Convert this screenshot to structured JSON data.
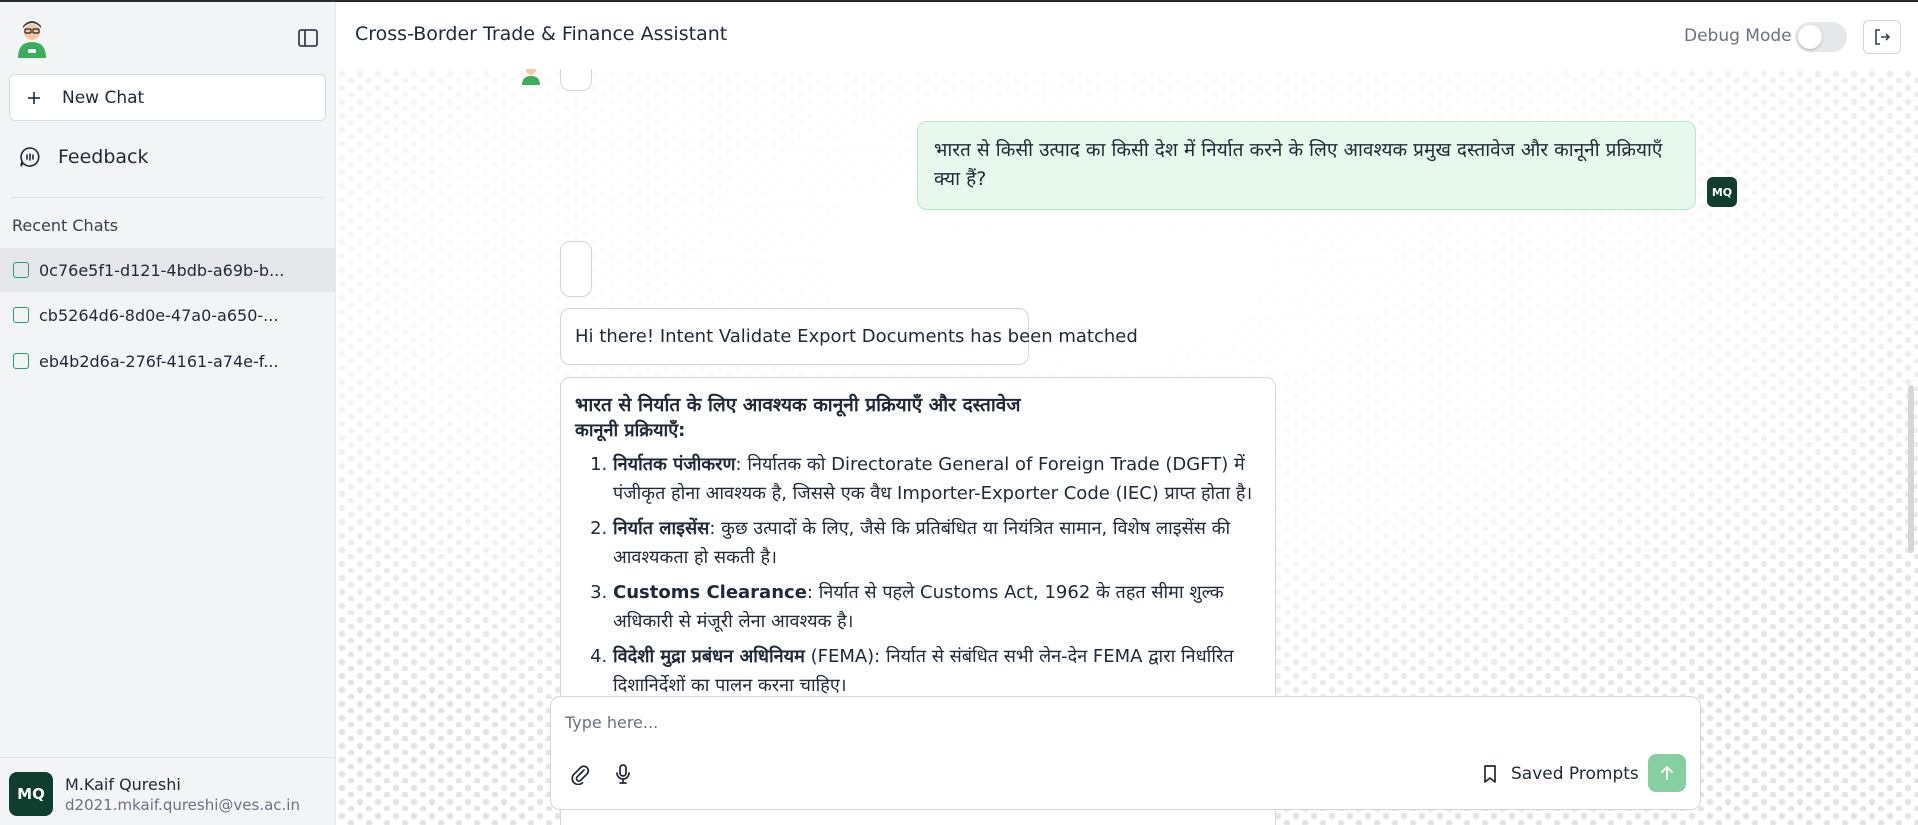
{
  "header": {
    "title": "Cross-Border Trade & Finance Assistant",
    "debug_label": "Debug Mode"
  },
  "sidebar": {
    "new_chat_label": "New Chat",
    "feedback_label": "Feedback",
    "recent_title": "Recent Chats",
    "recent_chats": [
      {
        "label": "0c76e5f1-d121-4bdb-a69b-b..."
      },
      {
        "label": "cb5264d6-8d0e-47a0-a650-..."
      },
      {
        "label": "eb4b2d6a-276f-4161-a74e-f..."
      }
    ],
    "user": {
      "initials": "MQ",
      "name": "M.Kaif Qureshi",
      "email": "d2021.mkaif.qureshi@ves.ac.in"
    }
  },
  "chat": {
    "user_message": "भारत से किसी उत्पाद का किसी देश में निर्यात करने के लिए आवश्यक प्रमुख दस्तावेज और कानूनी प्रक्रियाएँ क्या हैं?",
    "user_initials": "MQ",
    "intent_message": "Hi there! Intent Validate Export Documents has been matched",
    "answer": {
      "heading": "भारत से निर्यात के लिए आवश्यक कानूनी प्रक्रियाएँ और दस्तावेज",
      "subheading": "कानूनी प्रक्रियाएँ:",
      "items": [
        {
          "title": "निर्यातक पंजीकरण",
          "text": ": निर्यातक को Directorate General of Foreign Trade (DGFT) में पंजीकृत होना आवश्यक है, जिससे एक वैध Importer-Exporter Code (IEC) प्राप्त होता है।"
        },
        {
          "title": "निर्यात लाइसेंस",
          "text": ": कुछ उत्पादों के लिए, जैसे कि प्रतिबंधित या नियंत्रित सामान, विशेष लाइसेंस की आवश्यकता हो सकती है।"
        },
        {
          "title": "Customs Clearance",
          "text": ": निर्यात से पहले Customs Act, 1962 के तहत सीमा शुल्क अधिकारी से मंजूरी लेना आवश्यक है।"
        },
        {
          "title": "विदेशी मुद्रा प्रबंधन अधिनियम",
          "text": " (FEMA): निर्यात से संबंधित सभी लेन-देन FEMA द्वारा निर्धारित दिशानिर्देशों का पालन करना चाहिए।"
        }
      ]
    }
  },
  "composer": {
    "placeholder": "Type here...",
    "saved_prompts_label": "Saved Prompts"
  },
  "icons": {
    "logo": "assistant-logo",
    "collapse": "sidebar-toggle-icon",
    "new_chat": "plus-icon",
    "feedback": "feedback-icon",
    "logout": "logout-icon",
    "attach": "paperclip-icon",
    "mic": "microphone-icon",
    "bookmark": "bookmark-icon",
    "send": "arrow-up-icon"
  },
  "colors": {
    "brand_dark": "#0f3d2e",
    "user_bubble": "#e6f9ec",
    "send_button": "#86cfa3"
  }
}
